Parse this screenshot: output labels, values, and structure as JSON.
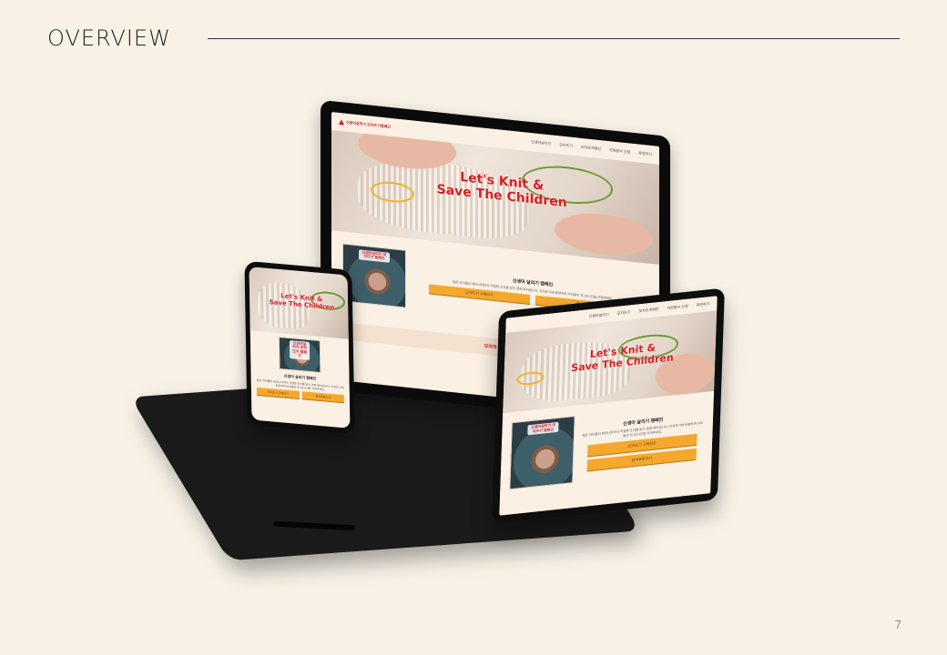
{
  "slide": {
    "title": "OVERVIEW",
    "page_number": "7"
  },
  "site": {
    "logo_text": "신생아살리기 모자뜨기캠페인",
    "nav": [
      "신생아살리기",
      "모자뜨기",
      "모자뜨게해인",
      "자원봉사 신청",
      "후원하기"
    ],
    "hero_title_line1": "Let's Knit &",
    "hero_title_line2": "Save The Children",
    "campaign_title": "신생아 살리기 캠페인",
    "campaign_desc": "많은 아이들이 태어나자마자 적절한 조치를 받지 못해 죽어갑니다. 모자뜨기에 동참하여 아이들의 첫 24시간을 지켜주세요.",
    "button_primary": "모자뜨기 구매하기",
    "button_secondary": "참여후원하기",
    "section_label": "모자의 여정",
    "photo_logo": "신생아살리기 모자뜨기 캠페인"
  },
  "colors": {
    "background": "#f7f1e6",
    "accent_red": "#d81e25",
    "button_orange": "#f4a82d",
    "ring_green": "#6a9a3b",
    "ring_yellow": "#e8b72a"
  }
}
